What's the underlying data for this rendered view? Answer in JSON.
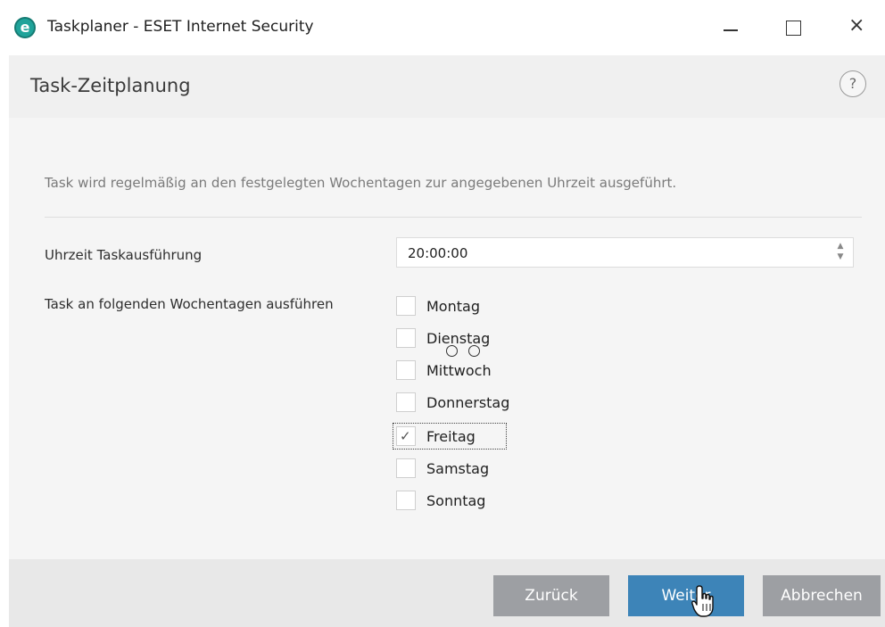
{
  "window": {
    "title": "Taskplaner - ESET Internet Security",
    "icon_letter": "e",
    "icon_name": "eset-logo-icon",
    "minimize_icon": "minimize-icon",
    "maximize_icon": "maximize-icon",
    "close_icon": "close-icon",
    "close_glyph": "×"
  },
  "header": {
    "title": "Task-Zeitplanung",
    "help_glyph": "?"
  },
  "content": {
    "description": "Task wird regelmäßig an den festgelegten Wochentagen zur angegebenen Uhrzeit ausgeführt.",
    "time_label": "Uhrzeit Taskausführung",
    "time_value": "20:00:00",
    "days_label": "Task an folgenden Wochentagen ausführen",
    "days": [
      {
        "label": "Montag",
        "checked": false
      },
      {
        "label": "Dienstag",
        "checked": false
      },
      {
        "label": "Mittwoch",
        "checked": false
      },
      {
        "label": "Donnerstag",
        "checked": false
      },
      {
        "label": "Freitag",
        "checked": true
      },
      {
        "label": "Samstag",
        "checked": false
      },
      {
        "label": "Sonntag",
        "checked": false
      }
    ]
  },
  "footer": {
    "back_label": "Zurück",
    "next_label": "Weiter",
    "cancel_label": "Abbrechen"
  },
  "colors": {
    "accent": "#3d84b8",
    "secondary_button": "#9d9fa3",
    "logo": "#1fa39a"
  }
}
